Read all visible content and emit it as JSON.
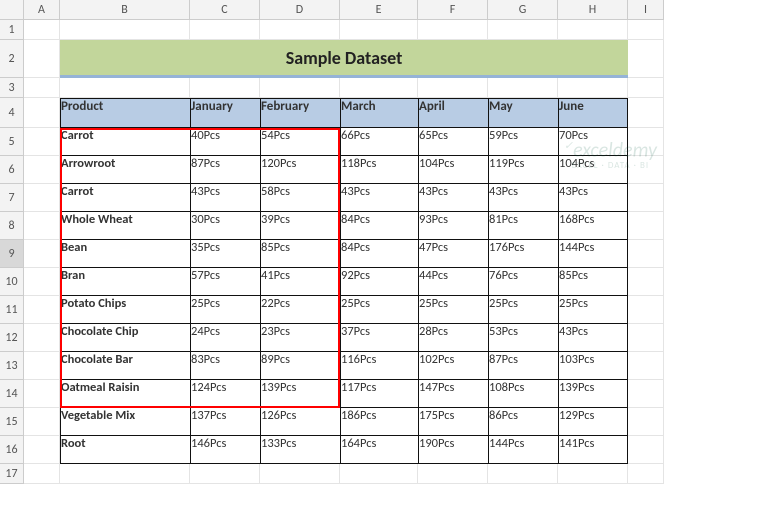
{
  "cols": [
    "A",
    "B",
    "C",
    "D",
    "E",
    "F",
    "G",
    "H",
    "I"
  ],
  "rows": [
    "1",
    "2",
    "3",
    "4",
    "5",
    "6",
    "7",
    "8",
    "9",
    "10",
    "11",
    "12",
    "13",
    "14",
    "15",
    "16",
    "17"
  ],
  "active_row": "9",
  "title": "Sample Dataset",
  "headers": [
    "Product",
    "January",
    "February",
    "March",
    "April",
    "May",
    "June"
  ],
  "data": [
    [
      "Carrot",
      "40Pcs",
      "54Pcs",
      "66Pcs",
      "65Pcs",
      "59Pcs",
      "70Pcs"
    ],
    [
      "Arrowroot",
      "87Pcs",
      "120Pcs",
      "118Pcs",
      "104Pcs",
      "119Pcs",
      "104Pcs"
    ],
    [
      "Carrot",
      "43Pcs",
      "58Pcs",
      "43Pcs",
      "43Pcs",
      "43Pcs",
      "43Pcs"
    ],
    [
      "Whole Wheat",
      "30Pcs",
      "39Pcs",
      "84Pcs",
      "93Pcs",
      "81Pcs",
      "168Pcs"
    ],
    [
      "Bean",
      "35Pcs",
      "85Pcs",
      "84Pcs",
      "47Pcs",
      "176Pcs",
      "144Pcs"
    ],
    [
      "Bran",
      "57Pcs",
      "41Pcs",
      "92Pcs",
      "44Pcs",
      "76Pcs",
      "85Pcs"
    ],
    [
      "Potato Chips",
      "25Pcs",
      "22Pcs",
      "25Pcs",
      "25Pcs",
      "25Pcs",
      "25Pcs"
    ],
    [
      "Chocolate Chip",
      "24Pcs",
      "23Pcs",
      "37Pcs",
      "28Pcs",
      "53Pcs",
      "43Pcs"
    ],
    [
      "Chocolate Bar",
      "83Pcs",
      "89Pcs",
      "116Pcs",
      "102Pcs",
      "87Pcs",
      "103Pcs"
    ],
    [
      "Oatmeal Raisin",
      "124Pcs",
      "139Pcs",
      "117Pcs",
      "147Pcs",
      "108Pcs",
      "139Pcs"
    ],
    [
      "Vegetable Mix",
      "137Pcs",
      "126Pcs",
      "186Pcs",
      "175Pcs",
      "86Pcs",
      "129Pcs"
    ],
    [
      "Root",
      "146Pcs",
      "133Pcs",
      "164Pcs",
      "190Pcs",
      "144Pcs",
      "141Pcs"
    ]
  ],
  "watermark": {
    "brand": "exceldemy",
    "tag": "EXCEL · DATA · BI"
  }
}
